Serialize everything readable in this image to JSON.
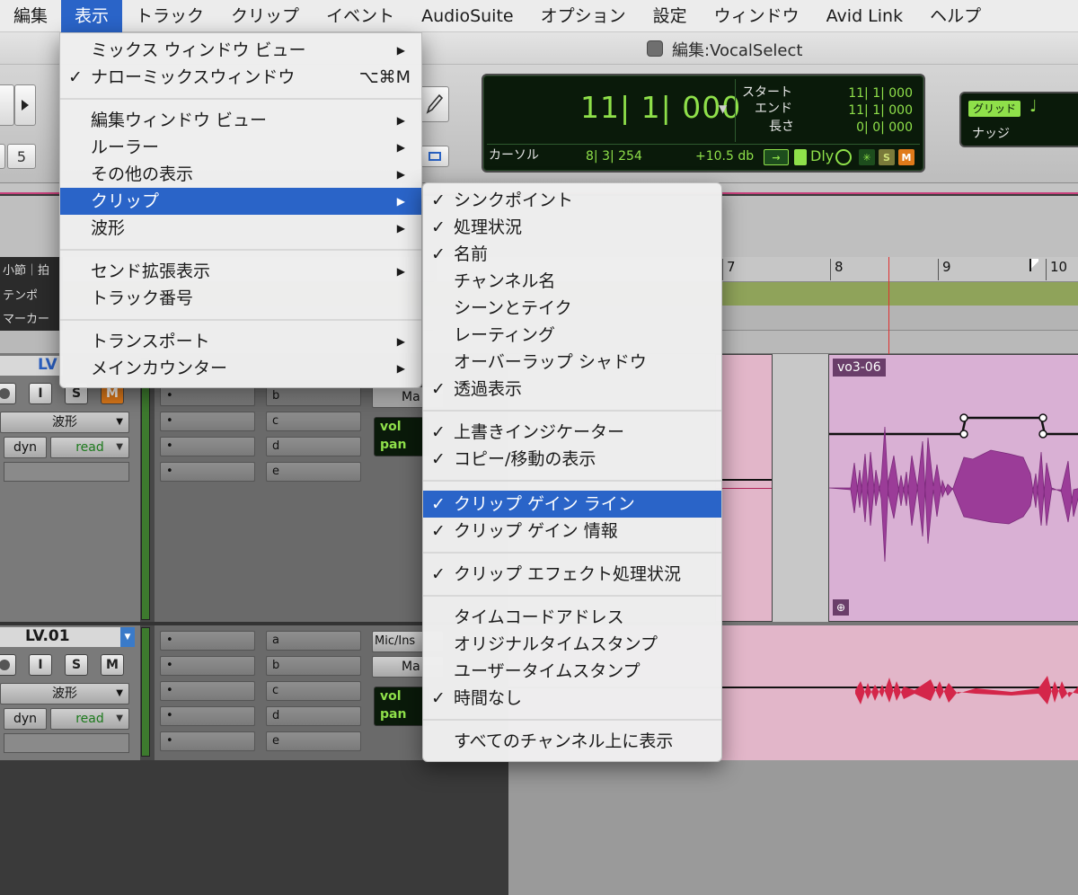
{
  "menubar": {
    "items": [
      "編集",
      "表示",
      "トラック",
      "クリップ",
      "イベント",
      "AudioSuite",
      "オプション",
      "設定",
      "ウィンドウ",
      "Avid Link",
      "ヘルプ"
    ],
    "active_index": 1
  },
  "window": {
    "title": "編集:VocalSelect"
  },
  "toolbar": {
    "btn_5": "5"
  },
  "counter": {
    "main": "11| 1| 000",
    "start_label": "スタート",
    "start_value": "11| 1| 000",
    "end_label": "エンド",
    "end_value": "11| 1| 000",
    "length_label": "長さ",
    "length_value": "0| 0| 000",
    "cursor_label": "カーソル",
    "cursor_value": "8| 3| 254",
    "db_value": "+10.5 db",
    "dly_label": "Dly",
    "s_label": "S",
    "m_label": "M"
  },
  "grid": {
    "grid_label": "グリッド",
    "nudge_label": "ナッジ"
  },
  "rulers": {
    "bars_label": "小節｜拍",
    "tempo_label": "テンポ",
    "marker_label": "マーカー",
    "bar_numbers": [
      "7",
      "8",
      "9",
      "10"
    ]
  },
  "tracks": [
    {
      "name": "LV",
      "rec_label": "",
      "input_label": "I",
      "solo_label": "S",
      "mute_label": "M",
      "view": "波形",
      "dyn": "dyn",
      "automation": "read",
      "sends": [
        "b",
        "c",
        "d",
        "e"
      ],
      "output_label": "Ma",
      "vol": "vol",
      "pan": "pan"
    },
    {
      "name": "LV.01",
      "rec_label": "",
      "input_label": "I",
      "solo_label": "S",
      "mute_label": "M",
      "view": "波形",
      "dyn": "dyn",
      "automation": "read",
      "sends": [
        "a",
        "b",
        "c",
        "d",
        "e"
      ],
      "io_label": "Mic/Ins",
      "output_label": "Ma",
      "vol": "vol",
      "pan": "pan"
    }
  ],
  "clips": {
    "clip_name": "vo3-06"
  },
  "view_menu": [
    {
      "label": "ミックス ウィンドウ ビュー",
      "checked": false,
      "submenu": true
    },
    {
      "label": "ナローミックスウィンドウ",
      "checked": true,
      "shortcut": "⌥⌘M"
    },
    {
      "label": "編集ウィンドウ ビュー",
      "checked": false,
      "submenu": true
    },
    {
      "label": "ルーラー",
      "checked": false,
      "submenu": true
    },
    {
      "label": "その他の表示",
      "checked": false,
      "submenu": true
    },
    {
      "label": "クリップ",
      "checked": false,
      "submenu": true,
      "highlighted": true
    },
    {
      "label": "波形",
      "checked": false,
      "submenu": true
    },
    {
      "label": "センド拡張表示",
      "checked": false,
      "submenu": true
    },
    {
      "label": "トラック番号",
      "checked": false
    },
    {
      "label": "トランスポート",
      "checked": false,
      "submenu": true
    },
    {
      "label": "メインカウンター",
      "checked": false,
      "submenu": true
    }
  ],
  "clip_submenu": [
    {
      "label": "シンクポイント",
      "checked": true
    },
    {
      "label": "処理状況",
      "checked": true
    },
    {
      "label": "名前",
      "checked": true
    },
    {
      "label": "チャンネル名",
      "checked": false
    },
    {
      "label": "シーンとテイク",
      "checked": false
    },
    {
      "label": "レーティング",
      "checked": false
    },
    {
      "label": "オーバーラップ シャドウ",
      "checked": false
    },
    {
      "label": "透過表示",
      "checked": true
    },
    {
      "label": "上書きインジケーター",
      "checked": true
    },
    {
      "label": "コピー/移動の表示",
      "checked": true
    },
    {
      "label": "クリップ ゲイン ライン",
      "checked": true,
      "highlighted": true
    },
    {
      "label": "クリップ ゲイン 情報",
      "checked": true
    },
    {
      "label": "クリップ エフェクト処理状況",
      "checked": true
    },
    {
      "label": "タイムコードアドレス",
      "checked": false
    },
    {
      "label": "オリジナルタイムスタンプ",
      "checked": false
    },
    {
      "label": "ユーザータイムスタンプ",
      "checked": false
    },
    {
      "label": "時間なし",
      "checked": true
    },
    {
      "label": "すべてのチャンネル上に表示",
      "checked": false
    }
  ],
  "glyphs": {
    "check": "✓",
    "arrow": "▶",
    "dropdown": "▼"
  }
}
